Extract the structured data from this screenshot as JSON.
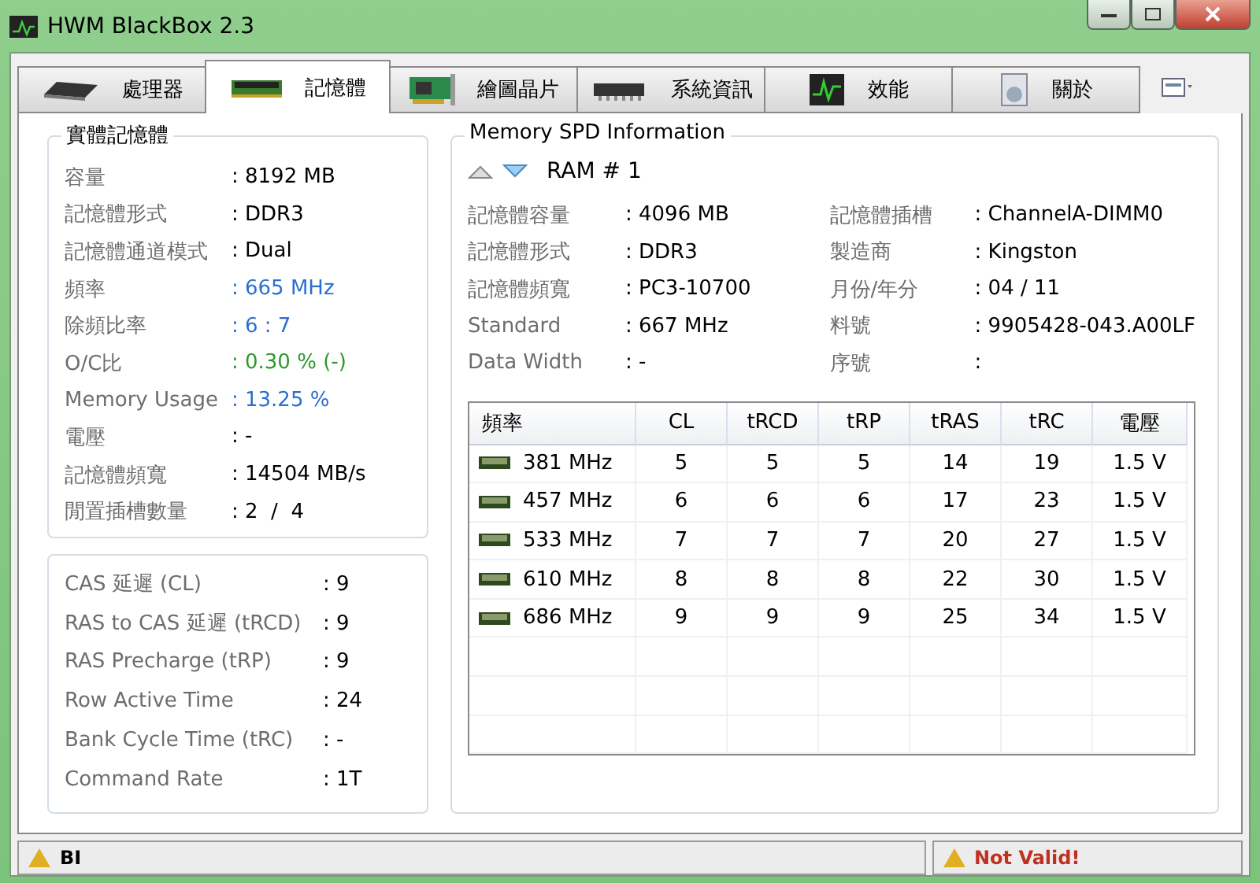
{
  "window": {
    "title": "HWM BlackBox 2.3"
  },
  "tabs": [
    {
      "label": "處理器",
      "selected": false
    },
    {
      "label": "記憶體",
      "selected": true
    },
    {
      "label": "繪圖晶片",
      "selected": false
    },
    {
      "label": "系統資訊",
      "selected": false
    },
    {
      "label": "效能",
      "selected": false
    },
    {
      "label": "關於",
      "selected": false
    }
  ],
  "physical_memory": {
    "title": "實體記憶體",
    "rows": [
      {
        "label": "容量",
        "value": ": 8192 MB"
      },
      {
        "label": "記憶體形式",
        "value": ": DDR3"
      },
      {
        "label": "記憶體通道模式",
        "value": ": Dual"
      },
      {
        "label": "頻率",
        "value": ": 665 MHz",
        "color": "#2a6fd0"
      },
      {
        "label": "除頻比率",
        "value": ": 6 : 7",
        "color": "#2a6fd0"
      },
      {
        "label": "O/C比",
        "value": ": 0.30 % (-)",
        "color": "#2a9a2a"
      },
      {
        "label": "Memory Usage",
        "value": ": 13.25 %",
        "color": "#2a6fd0"
      },
      {
        "label": "電壓",
        "value": ": -"
      },
      {
        "label": "記憶體頻寬",
        "value": ": 14504 MB/s"
      },
      {
        "label": "閒置插槽數量",
        "value": ": 2  /  4"
      }
    ]
  },
  "timings": [
    {
      "label": "CAS 延遲 (CL)",
      "value": ": 9"
    },
    {
      "label": "RAS to CAS 延遲 (tRCD)",
      "value": ": 9"
    },
    {
      "label": "RAS Precharge (tRP)",
      "value": ": 9"
    },
    {
      "label": "Row Active Time",
      "value": ": 24"
    },
    {
      "label": "Bank Cycle Time (tRC)",
      "value": ": -"
    },
    {
      "label": "Command Rate",
      "value": ": 1T"
    }
  ],
  "spd": {
    "title": "Memory SPD Information",
    "module": "RAM # 1",
    "left": [
      {
        "label": "記憶體容量",
        "value": ": 4096 MB"
      },
      {
        "label": "記憶體形式",
        "value": ": DDR3"
      },
      {
        "label": "記憶體頻寬",
        "value": ": PC3-10700"
      },
      {
        "label": "Standard",
        "value": ": 667 MHz"
      },
      {
        "label": "Data Width",
        "value": ": -"
      }
    ],
    "right": [
      {
        "label": "記憶體插槽",
        "value": ": ChannelA-DIMM0"
      },
      {
        "label": "製造商",
        "value": ": Kingston"
      },
      {
        "label": "月份/年分",
        "value": ": 04 / 11"
      },
      {
        "label": "料號",
        "value": ": 9905428-043.A00LF"
      },
      {
        "label": "序號",
        "value": ":"
      }
    ],
    "table": {
      "columns": [
        "頻率",
        "CL",
        "tRCD",
        "tRP",
        "tRAS",
        "tRC",
        "電壓"
      ],
      "rows": [
        [
          "381 MHz",
          "5",
          "5",
          "5",
          "14",
          "19",
          "1.5 V"
        ],
        [
          "457 MHz",
          "6",
          "6",
          "6",
          "17",
          "23",
          "1.5 V"
        ],
        [
          "533 MHz",
          "7",
          "7",
          "7",
          "20",
          "27",
          "1.5 V"
        ],
        [
          "610 MHz",
          "8",
          "8",
          "8",
          "22",
          "30",
          "1.5 V"
        ],
        [
          "686 MHz",
          "9",
          "9",
          "9",
          "25",
          "34",
          "1.5 V"
        ]
      ]
    }
  },
  "status_bar": {
    "left": "BI",
    "right": "Not Valid!"
  }
}
